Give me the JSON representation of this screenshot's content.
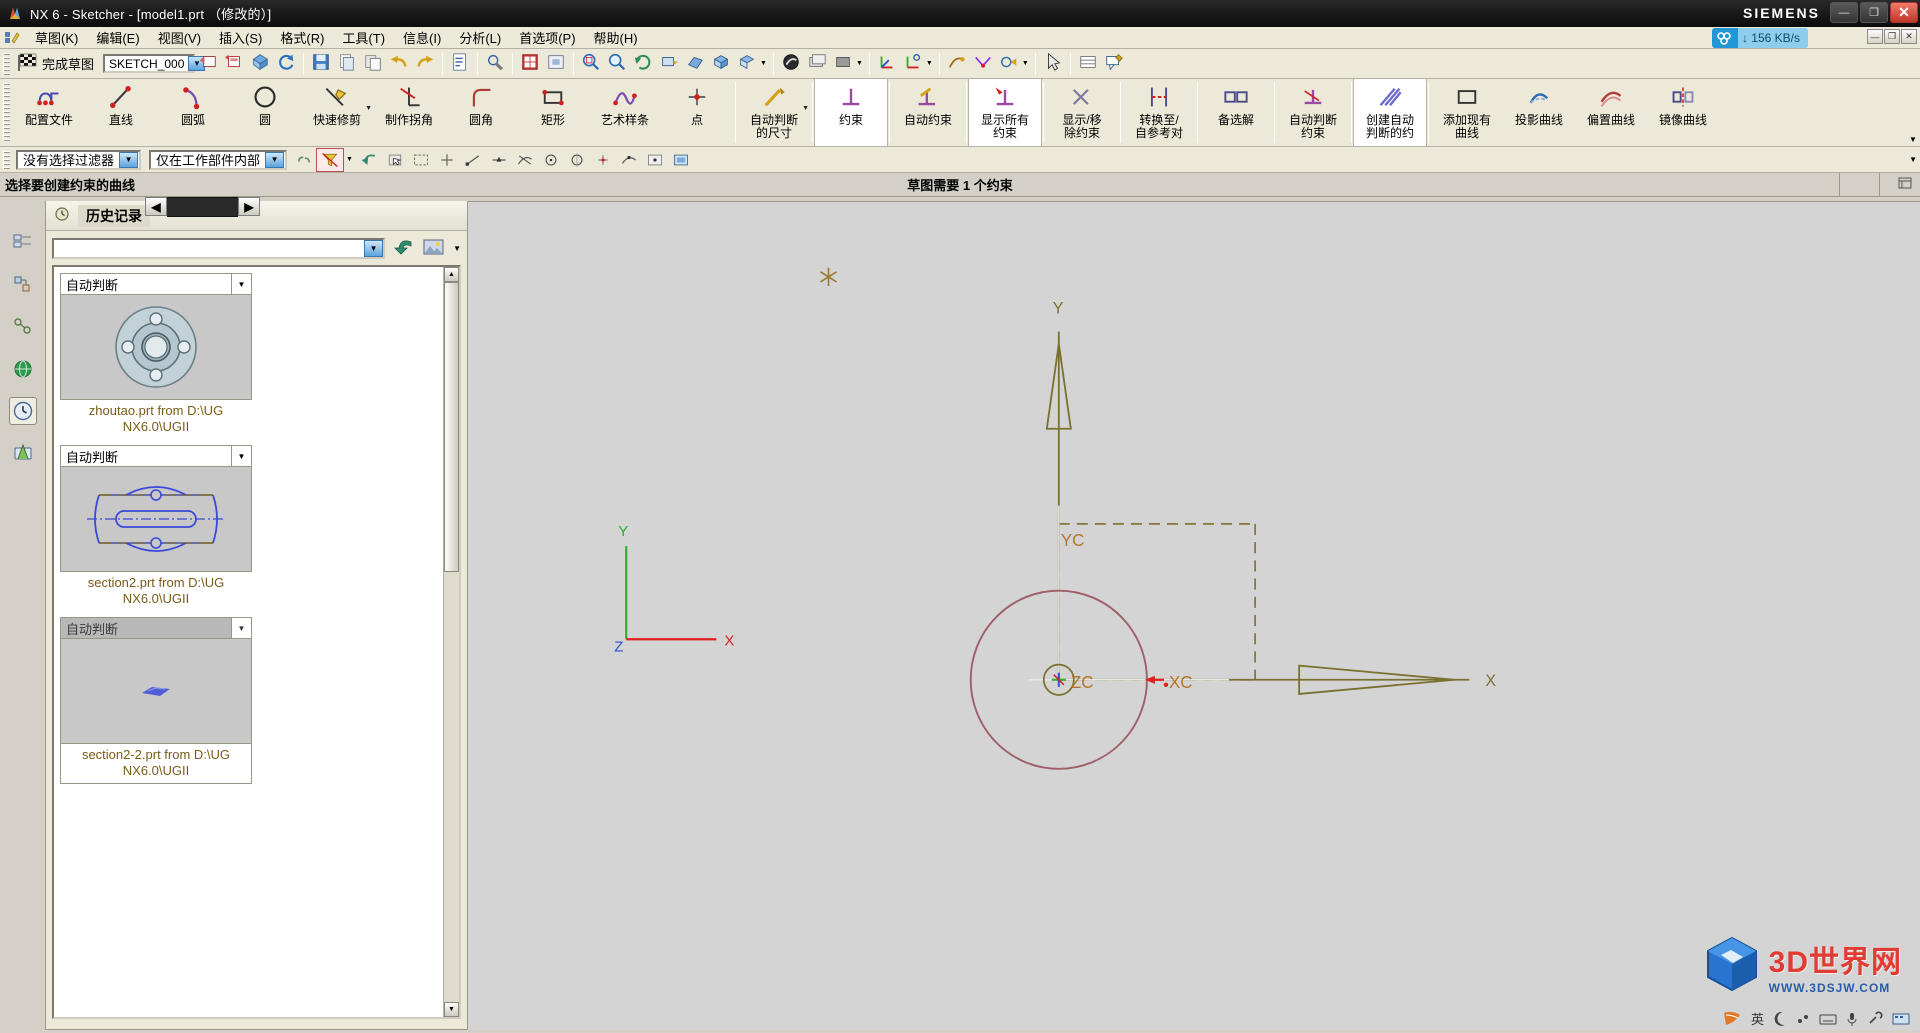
{
  "window": {
    "title": "NX 6 - Sketcher - [model1.prt （修改的）]",
    "brand": "SIEMENS",
    "app_icon": "nx-logo-icon",
    "min_label": "—",
    "max_label": "❐",
    "close_label": "✕"
  },
  "network": {
    "icon": "network-icon",
    "value": "↓ 156 KB/s"
  },
  "menu": {
    "logo_icon": "sketch-app-icon",
    "items": [
      {
        "label": "草图(K)",
        "name": "menu-sketch"
      },
      {
        "label": "编辑(E)",
        "name": "menu-edit"
      },
      {
        "label": "视图(V)",
        "name": "menu-view"
      },
      {
        "label": "插入(S)",
        "name": "menu-insert"
      },
      {
        "label": "格式(R)",
        "name": "menu-format"
      },
      {
        "label": "工具(T)",
        "name": "menu-tools"
      },
      {
        "label": "信息(I)",
        "name": "menu-info"
      },
      {
        "label": "分析(L)",
        "name": "menu-analysis"
      },
      {
        "label": "首选项(P)",
        "name": "menu-preferences"
      },
      {
        "label": "帮助(H)",
        "name": "menu-help"
      }
    ],
    "mdi_buttons": [
      "—",
      "❐",
      "✕"
    ]
  },
  "toolbar_small": {
    "finish_sketch_label": "完成草图",
    "finish_sketch_icon": "checkered-flag-icon",
    "sketch_name_value": "SKETCH_000",
    "sketch_name_arrow": "▼",
    "icons": [
      {
        "name": "reattach-sketch-icon"
      },
      {
        "name": "orient-view-to-sketch-icon"
      },
      {
        "name": "update-model-icon"
      },
      {
        "name": "refresh-icon"
      },
      {
        "name": "save-icon"
      },
      {
        "name": "cut-icon"
      },
      {
        "name": "copy-icon"
      },
      {
        "name": "undo-icon"
      },
      {
        "name": "redo-icon"
      },
      {
        "name": "information-icon"
      },
      {
        "name": "selection-tools-icon"
      },
      {
        "name": "grid-toggle-icon"
      },
      {
        "name": "fit-view-icon"
      },
      {
        "name": "zoom-window-icon"
      },
      {
        "name": "zoom-icon"
      },
      {
        "name": "rotate-icon"
      },
      {
        "name": "pan-icon"
      },
      {
        "name": "perspective-icon"
      },
      {
        "name": "shaded-view-icon"
      },
      {
        "name": "trimetric-view-icon"
      },
      {
        "name": "render-style-icon"
      },
      {
        "name": "layer-settings-icon"
      },
      {
        "name": "color-swatch-icon"
      },
      {
        "name": "wcs-icon"
      },
      {
        "name": "dynamic-wcs-icon"
      },
      {
        "name": "sketch-constraint1-icon"
      },
      {
        "name": "sketch-constraint2-icon"
      },
      {
        "name": "sketch-constraint3-icon"
      },
      {
        "name": "selection-arrow-icon"
      },
      {
        "name": "table-icon"
      },
      {
        "name": "annotation-icon"
      }
    ]
  },
  "ribbon": {
    "items": [
      {
        "label": "配置文件",
        "name": "profile",
        "icon": "profile-curve-icon",
        "selected": false,
        "caret": false
      },
      {
        "label": "直线",
        "name": "line",
        "icon": "line-icon",
        "selected": false,
        "caret": false
      },
      {
        "label": "圆弧",
        "name": "arc",
        "icon": "arc-icon",
        "selected": false,
        "caret": false
      },
      {
        "label": "圆",
        "name": "circle",
        "icon": "circle-icon",
        "selected": false,
        "caret": false
      },
      {
        "label": "快速修剪",
        "name": "quick-trim",
        "icon": "quick-trim-icon",
        "selected": false,
        "caret": true
      },
      {
        "label": "制作拐角",
        "name": "make-corner",
        "icon": "make-corner-icon",
        "selected": false,
        "caret": false
      },
      {
        "label": "圆角",
        "name": "fillet",
        "icon": "fillet-icon",
        "selected": false,
        "caret": false
      },
      {
        "label": "矩形",
        "name": "rectangle",
        "icon": "rectangle-icon",
        "selected": false,
        "caret": false
      },
      {
        "label": "艺术样条",
        "name": "studio-spline",
        "icon": "spline-icon",
        "selected": false,
        "caret": false
      },
      {
        "label": "点",
        "name": "point",
        "icon": "point-icon",
        "selected": false,
        "caret": false
      },
      {
        "label": "自动判断\n的尺寸",
        "name": "inferred-dimension",
        "icon": "inferred-dimension-icon",
        "selected": false,
        "caret": true
      },
      {
        "label": "约束",
        "name": "constraint",
        "icon": "constraint-icon",
        "selected": true,
        "caret": false
      },
      {
        "label": "自动约束",
        "name": "auto-constraint",
        "icon": "auto-constraint-icon",
        "selected": false,
        "caret": false
      },
      {
        "label": "显示所有\n约束",
        "name": "show-all-constraints",
        "icon": "show-all-constraints-icon",
        "selected": true,
        "caret": false
      },
      {
        "label": "显示/移\n除约束",
        "name": "show-remove-constraints",
        "icon": "show-remove-constraints-icon",
        "selected": false,
        "caret": false
      },
      {
        "label": "转换至/\n自参考对",
        "name": "convert-to-reference",
        "icon": "convert-reference-icon",
        "selected": false,
        "caret": false
      },
      {
        "label": "备选解",
        "name": "alternate-solution",
        "icon": "alternate-solution-icon",
        "selected": false,
        "caret": false
      },
      {
        "label": "自动判断\n约束",
        "name": "inferred-constraints",
        "icon": "inferred-constraints-icon",
        "selected": false,
        "caret": false
      },
      {
        "label": "创建自动\n判断的约",
        "name": "create-inferred-constraints",
        "icon": "create-inferred-icon",
        "selected": true,
        "caret": false
      },
      {
        "label": "添加现有\n曲线",
        "name": "add-existing-curve",
        "icon": "add-existing-curve-icon",
        "selected": false,
        "caret": false
      },
      {
        "label": "投影曲线",
        "name": "project-curve",
        "icon": "project-curve-icon",
        "selected": false,
        "caret": false
      },
      {
        "label": "偏置曲线",
        "name": "offset-curve",
        "icon": "offset-curve-icon",
        "selected": false,
        "caret": false
      },
      {
        "label": "镜像曲线",
        "name": "mirror-curve",
        "icon": "mirror-curve-icon",
        "selected": false,
        "caret": false
      }
    ]
  },
  "filterbar": {
    "selection_filter_value": "没有选择过滤器",
    "scope_value": "仅在工作部件内部",
    "arrow": "▼",
    "icons": [
      {
        "name": "select-chain-icon"
      },
      {
        "name": "filter-highlight-icon",
        "highlight": true
      },
      {
        "name": "back-arrow-icon"
      },
      {
        "name": "select-face-icon"
      },
      {
        "name": "rect-select-icon"
      },
      {
        "name": "snap-point-icon"
      },
      {
        "name": "snap-end-icon"
      },
      {
        "name": "snap-mid-icon"
      },
      {
        "name": "snap-intersection-icon"
      },
      {
        "name": "snap-arc-center-icon"
      },
      {
        "name": "snap-quadrant-icon"
      },
      {
        "name": "snap-existing-point-icon"
      },
      {
        "name": "snap-point-on-curve-icon"
      },
      {
        "name": "snap-point-on-face-icon"
      },
      {
        "name": "display-mode-icon"
      }
    ],
    "scroll_caret": "▼"
  },
  "cuebar": {
    "prompt": "选择要创建约束的曲线",
    "status": "草图需要 1 个约束",
    "right_icon": "status-info-icon"
  },
  "resize_bar": {
    "left": "◀",
    "right": "▶"
  },
  "rail": {
    "items": [
      {
        "name": "part-navigator-icon"
      },
      {
        "name": "assembly-navigator-icon"
      },
      {
        "name": "constraint-navigator-icon"
      },
      {
        "name": "web-browser-icon"
      },
      {
        "name": "history-icon",
        "selected": true
      },
      {
        "name": "roles-icon"
      }
    ]
  },
  "navigator": {
    "title": "历史记录",
    "title_icon": "history-panel-icon",
    "search_value": "",
    "search_arrow": "▼",
    "back_icon": "undo-arrow-icon",
    "image_icon": "thumbnail-view-icon",
    "image_caret": "▼",
    "cards": [
      {
        "dropdown_label": "自动判断",
        "dropdown_arrow": "▼",
        "caption": "zhoutao.prt from D:\\UG NX6.0\\UGII",
        "thumb": "flange-part-icon",
        "dimmed": false,
        "caption_boxed": false
      },
      {
        "dropdown_label": "自动判断",
        "dropdown_arrow": "▼",
        "caption": "section2.prt from D:\\UG NX6.0\\UGII",
        "thumb": "section-sketch-icon",
        "dimmed": false,
        "caption_boxed": false
      },
      {
        "dropdown_label": "自动判断",
        "dropdown_arrow": "▼",
        "caption": "section2-2.prt from D:\\UG NX6.0\\UGII",
        "thumb": "small-sketch-icon",
        "dimmed": true,
        "caption_boxed": true
      }
    ],
    "scroll_up": "▲",
    "scroll_down": "▼"
  },
  "graphics": {
    "axis_y_label": "Y",
    "axis_x_label": "X",
    "wcs_yc_label": "YC",
    "wcs_xc_label": "XC",
    "wcs_origin_label": "ZC",
    "triad_x": "X",
    "triad_y": "Y",
    "triad_z": "Z",
    "colors": {
      "background": "#d4d4d4",
      "circle": "#9e5f68",
      "axis": "#7a7030",
      "wcs_text": "#b5762a",
      "triad_x": "#e02020",
      "triad_y": "#20a020",
      "triad_z": "#2020d0",
      "marker_red": "#e02020"
    }
  },
  "watermark": {
    "text": "3D世界网",
    "sub": "WWW.3DSJW.COM",
    "icon": "cube-logo-icon"
  },
  "ime": {
    "icons": [
      "chinese-input-icon",
      "moon-icon",
      "dot-icon",
      "keyboard-icon",
      "mic-icon",
      "tools-icon",
      "soft-keyboard-icon"
    ],
    "label": "英"
  }
}
